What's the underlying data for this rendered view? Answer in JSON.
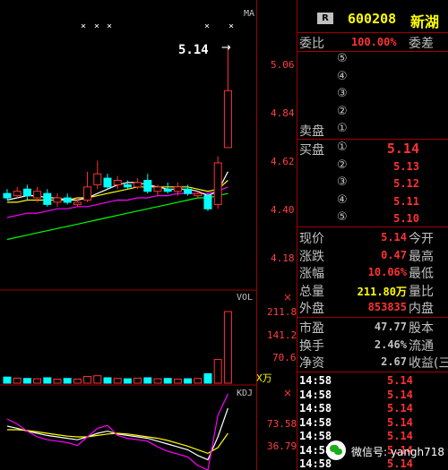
{
  "colors": {
    "background": "#000000",
    "grid": "#a00000",
    "up": "#ff3232",
    "down": "#00ffff",
    "ma5": "#ffffff",
    "ma10": "#ffff00",
    "ma20": "#ff00ff",
    "ma60": "#00ff00"
  },
  "chart": {
    "ma_label": "MA",
    "last_price_tag": "5.14",
    "x_marks": [
      "×",
      "×",
      "×",
      "×",
      "×"
    ],
    "price_scale": [
      "5.06",
      "4.84",
      "4.62",
      "4.40",
      "4.18"
    ],
    "vol_label": "VOL",
    "vol_scale": [
      "211.8",
      "141.2",
      "70.6"
    ],
    "vol_unit": "X万",
    "kdj_label": "KDJ",
    "kdj_scale": [
      "73.58",
      "36.79"
    ]
  },
  "chart_data": {
    "type": "candlestick",
    "price_ylim": [
      4.05,
      5.2
    ],
    "candles": [
      {
        "o": 4.47,
        "c": 4.45,
        "h": 4.49,
        "l": 4.44
      },
      {
        "o": 4.46,
        "c": 4.48,
        "h": 4.5,
        "l": 4.45
      },
      {
        "o": 4.49,
        "c": 4.46,
        "h": 4.51,
        "l": 4.44
      },
      {
        "o": 4.45,
        "c": 4.48,
        "h": 4.5,
        "l": 4.43
      },
      {
        "o": 4.47,
        "c": 4.42,
        "h": 4.49,
        "l": 4.41
      },
      {
        "o": 4.43,
        "c": 4.45,
        "h": 4.47,
        "l": 4.41
      },
      {
        "o": 4.45,
        "c": 4.43,
        "h": 4.47,
        "l": 4.42
      },
      {
        "o": 4.42,
        "c": 4.43,
        "h": 4.45,
        "l": 4.41
      },
      {
        "o": 4.44,
        "c": 4.5,
        "h": 4.57,
        "l": 4.43
      },
      {
        "o": 4.51,
        "c": 4.56,
        "h": 4.62,
        "l": 4.49
      },
      {
        "o": 4.54,
        "c": 4.5,
        "h": 4.56,
        "l": 4.49
      },
      {
        "o": 4.51,
        "c": 4.53,
        "h": 4.55,
        "l": 4.49
      },
      {
        "o": 4.51,
        "c": 4.5,
        "h": 4.53,
        "l": 4.49
      },
      {
        "o": 4.5,
        "c": 4.52,
        "h": 4.54,
        "l": 4.49
      },
      {
        "o": 4.53,
        "c": 4.48,
        "h": 4.56,
        "l": 4.47
      },
      {
        "o": 4.48,
        "c": 4.5,
        "h": 4.51,
        "l": 4.46
      },
      {
        "o": 4.49,
        "c": 4.48,
        "h": 4.52,
        "l": 4.47
      },
      {
        "o": 4.48,
        "c": 4.5,
        "h": 4.52,
        "l": 4.46
      },
      {
        "o": 4.49,
        "c": 4.47,
        "h": 4.51,
        "l": 4.46
      },
      {
        "o": 4.46,
        "c": 4.47,
        "h": 4.48,
        "l": 4.45
      },
      {
        "o": 4.46,
        "c": 4.4,
        "h": 4.47,
        "l": 4.39
      },
      {
        "o": 4.42,
        "c": 4.61,
        "h": 4.64,
        "l": 4.4
      },
      {
        "o": 4.68,
        "c": 4.94,
        "h": 5.14,
        "l": 4.87
      }
    ],
    "ma": {
      "ma5": [
        4.44,
        4.45,
        4.46,
        4.46,
        4.45,
        4.45,
        4.44,
        4.44,
        4.45,
        4.47,
        4.49,
        4.51,
        4.52,
        4.52,
        4.51,
        4.5,
        4.49,
        4.49,
        4.49,
        4.48,
        4.46,
        4.48,
        4.57
      ],
      "ma10": [
        4.43,
        4.43,
        4.44,
        4.44,
        4.44,
        4.44,
        4.44,
        4.45,
        4.45,
        4.46,
        4.47,
        4.48,
        4.49,
        4.5,
        4.5,
        4.5,
        4.5,
        4.5,
        4.5,
        4.49,
        4.48,
        4.49,
        4.53
      ],
      "ma20": [
        4.36,
        4.37,
        4.38,
        4.38,
        4.39,
        4.4,
        4.4,
        4.41,
        4.41,
        4.42,
        4.43,
        4.44,
        4.44,
        4.45,
        4.45,
        4.46,
        4.46,
        4.47,
        4.47,
        4.47,
        4.47,
        4.48,
        4.5
      ],
      "ma60": [
        4.26,
        4.27,
        4.28,
        4.29,
        4.3,
        4.31,
        4.32,
        4.33,
        4.34,
        4.35,
        4.36,
        4.37,
        4.38,
        4.39,
        4.4,
        4.41,
        4.42,
        4.43,
        4.44,
        4.45,
        4.45,
        4.46,
        4.47
      ]
    },
    "vol_ylim": [
      0,
      230
    ],
    "volume": [
      18,
      15,
      14,
      13,
      16,
      12,
      14,
      12,
      20,
      22,
      16,
      14,
      13,
      15,
      16,
      13,
      14,
      12,
      13,
      14,
      28,
      70,
      212
    ],
    "kdj_ylim": [
      0,
      100
    ],
    "k": [
      55,
      52,
      48,
      45,
      42,
      40,
      38,
      36,
      40,
      45,
      48,
      44,
      42,
      40,
      38,
      34,
      30,
      26,
      22,
      14,
      8,
      40,
      80
    ],
    "d": [
      50,
      50,
      49,
      47,
      45,
      43,
      41,
      40,
      40,
      42,
      44,
      45,
      44,
      42,
      40,
      38,
      35,
      31,
      27,
      22,
      17,
      25,
      45
    ],
    "j": [
      65,
      58,
      48,
      40,
      36,
      34,
      32,
      28,
      40,
      52,
      56,
      42,
      38,
      36,
      34,
      26,
      20,
      16,
      12,
      0,
      -10,
      70,
      120
    ]
  },
  "quote": {
    "header": {
      "badge": "R",
      "code": "600208",
      "name": "新湖"
    },
    "commission_ratio": {
      "label": "委比",
      "value": "100.00%",
      "diff_label": "委差"
    },
    "sell_label": "卖盘",
    "buy_label": "买盘",
    "levels": [
      "①",
      "②",
      "③",
      "④",
      "⑤"
    ],
    "sell": [
      {
        "level": "⑤",
        "price": "",
        "vol": ""
      },
      {
        "level": "④",
        "price": "",
        "vol": ""
      },
      {
        "level": "③",
        "price": "",
        "vol": ""
      },
      {
        "level": "②",
        "price": "",
        "vol": ""
      },
      {
        "level": "①",
        "price": "",
        "vol": ""
      }
    ],
    "buy": [
      {
        "level": "①",
        "price": "5.14"
      },
      {
        "level": "②",
        "price": "5.13"
      },
      {
        "level": "③",
        "price": "5.12"
      },
      {
        "level": "④",
        "price": "5.11"
      },
      {
        "level": "⑤",
        "price": "5.10"
      }
    ],
    "stats": [
      {
        "label": "现价",
        "value": "5.14",
        "label2": "今开",
        "color": "#ff3232"
      },
      {
        "label": "涨跌",
        "value": "0.47",
        "label2": "最高",
        "color": "#ff3232"
      },
      {
        "label": "涨幅",
        "value": "10.06%",
        "label2": "最低",
        "color": "#ff3232"
      },
      {
        "label": "总量",
        "value": "211.80万",
        "label2": "量比",
        "color": "#ffff00"
      },
      {
        "label": "外盘",
        "value": "853835",
        "label2": "内盘",
        "color": "#ff3232"
      }
    ],
    "stats2": [
      {
        "label": "市盈",
        "value": "47.77",
        "label2": "股本",
        "color": "#c0c0c0"
      },
      {
        "label": "换手",
        "value": "2.46%",
        "label2": "流通",
        "color": "#c0c0c0"
      },
      {
        "label": "净资",
        "value": "2.67",
        "label2": "收益(三",
        "color": "#c0c0c0"
      }
    ],
    "ticks": [
      {
        "time": "14:58",
        "price": "5.14"
      },
      {
        "time": "14:58",
        "price": "5.14"
      },
      {
        "time": "14:58",
        "price": "5.14"
      },
      {
        "time": "14:58",
        "price": "5.14"
      },
      {
        "time": "14:58",
        "price": "5.14"
      },
      {
        "time": "14:58",
        "price": "5.14"
      },
      {
        "time": "14:58",
        "price": "5.14"
      }
    ]
  },
  "watermark": "微信号: yangh718"
}
